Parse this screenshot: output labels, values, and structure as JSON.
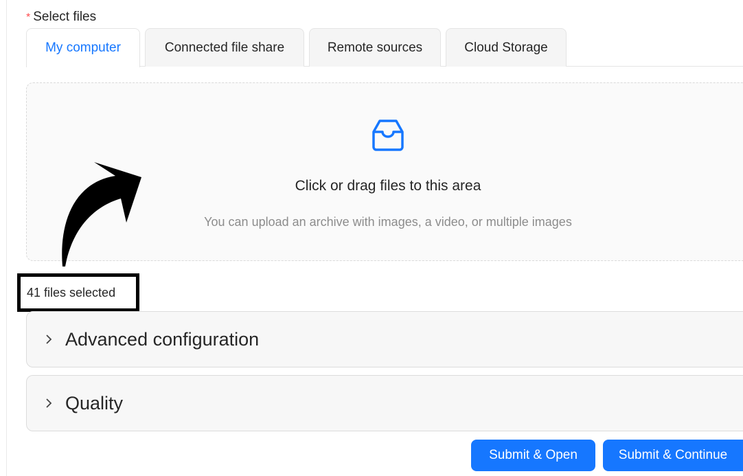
{
  "form": {
    "required_marker": "*",
    "label": "Select files"
  },
  "tabs": [
    {
      "label": "My computer",
      "active": true
    },
    {
      "label": "Connected file share",
      "active": false
    },
    {
      "label": "Remote sources",
      "active": false
    },
    {
      "label": "Cloud Storage",
      "active": false
    }
  ],
  "dropzone": {
    "icon": "inbox-icon",
    "title": "Click or drag files to this area",
    "hint": "You can upload an archive with images, a video, or multiple images"
  },
  "status": {
    "files_selected": "41 files selected"
  },
  "sections": [
    {
      "title": "Advanced configuration",
      "expanded": false
    },
    {
      "title": "Quality",
      "expanded": false
    }
  ],
  "actions": {
    "submit_open": "Submit & Open",
    "submit_continue": "Submit & Continue"
  },
  "colors": {
    "accent": "#1677ff",
    "required": "#ff4d4f",
    "annotation": "#000000"
  }
}
